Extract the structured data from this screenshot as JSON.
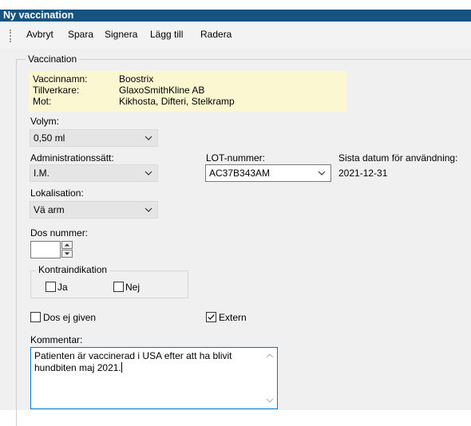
{
  "window": {
    "title": "Ny vaccination"
  },
  "toolbar": {
    "cancel_label": "Avbryt",
    "save_label": "Spara",
    "sign_label": "Signera",
    "add_label": "Lägg till",
    "delete_label": "Radera"
  },
  "vaccination": {
    "group_label": "Vaccination",
    "info": [
      {
        "key": "Vaccinnamn:",
        "value": "Boostrix"
      },
      {
        "key": "Tillverkare:",
        "value": "GlaxoSmithKline AB"
      },
      {
        "key": "Mot:",
        "value": "Kikhosta, Difteri, Stelkramp"
      }
    ]
  },
  "fields": {
    "volym_label": "Volym:",
    "volym_value": "0,50 ml",
    "admin_label": "Administrationssätt:",
    "admin_value": "I.M.",
    "lot_label": "LOT-nummer:",
    "lot_value": "AC37B343AM",
    "expiry_label": "Sista datum för användning:",
    "expiry_value": "2021-12-31",
    "lokalisation_label": "Lokalisation:",
    "lokalisation_value": "Vä arm",
    "dos_label": "Dos nummer:",
    "dos_value": ""
  },
  "kontraindikation": {
    "label": "Kontraindikation",
    "ja_label": "Ja",
    "nej_label": "Nej",
    "ja_checked": false,
    "nej_checked": false
  },
  "flags": {
    "dos_ej_given_label": "Dos ej given",
    "dos_ej_given_checked": false,
    "extern_label": "Extern",
    "extern_checked": true
  },
  "comment": {
    "label": "Kommentar:",
    "line1": "Patienten är vaccinerad i USA efter att ha blivit",
    "line2": "hundbiten maj 2021."
  },
  "colors": {
    "title_bar": "#16537e",
    "info_background": "#fbf8d1",
    "focus_border": "#0078d7"
  }
}
